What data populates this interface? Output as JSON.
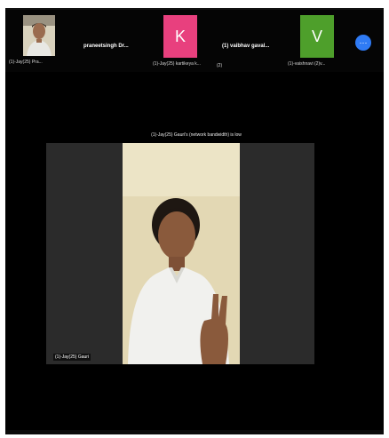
{
  "participants": [
    {
      "name": "",
      "label": "(1)-Jay(25) Pra...",
      "avatar": "photo"
    },
    {
      "name": "praneetsingh  Dr...",
      "label": "",
      "avatar": ""
    },
    {
      "name": "",
      "label": "(1)-Jay(25) kartikeya k...",
      "avatar": "K",
      "color": "#e8407e"
    },
    {
      "name": "(1) vaibhav gaval...",
      "label": "(2)",
      "avatar": ""
    },
    {
      "name": "",
      "label": "(1)-vaishnavi (2)v...",
      "avatar": "V",
      "color": "#4e9f2b"
    }
  ],
  "more_button": {
    "icon": "more-icon",
    "glyph": "⋯"
  },
  "main": {
    "status": "(1)-Jay(25) Gauri's (network bandwidth) is low",
    "label": "(1)-Jay(25) Gauri"
  },
  "colors": {
    "background": "#000000",
    "accent": "#2f7bf5"
  }
}
